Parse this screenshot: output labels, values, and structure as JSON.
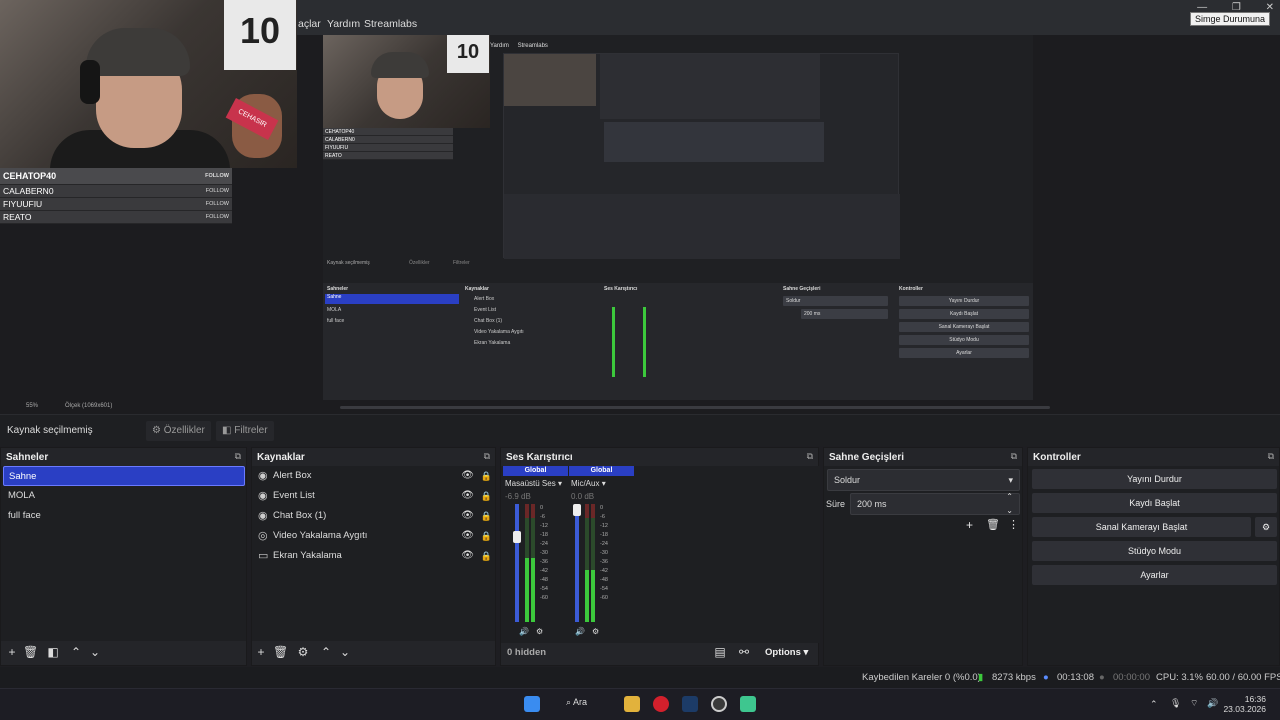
{
  "menubar": {
    "items": [
      "açlar",
      "Yardım",
      "Streamlabs"
    ],
    "tooltip": "Simge Durumuna",
    "window_controls": [
      "—",
      "❐",
      "✕"
    ]
  },
  "webcam": {
    "shirt_number": "10",
    "sign_text": "CEHASIR"
  },
  "chat": {
    "rows": [
      {
        "name": "CEHATOP40",
        "action": "FOLLOW"
      },
      {
        "name": "CALABERN0",
        "action": "FOLLOW"
      },
      {
        "name": "FIYUUFIU",
        "action": "FOLLOW"
      },
      {
        "name": "REATO",
        "action": "FOLLOW"
      }
    ]
  },
  "nested": {
    "menu": [
      "Yardım",
      "Streamlabs"
    ],
    "chat": [
      "CEHATOP40",
      "CALABERN0",
      "FIYUUFIU",
      "REATO"
    ],
    "source_label": "Kaynak seçilmemiş",
    "props_btn": "Özellikler",
    "filters_btn": "Filtreler",
    "panels": {
      "scenes_title": "Sahneler",
      "scenes": [
        "Sahne",
        "MOLA",
        "full face"
      ],
      "sources_title": "Kaynaklar",
      "sources": [
        "Alert Box",
        "Event List",
        "Chat Box (1)",
        "Video Yakalama Aygıtı",
        "Ekran Yakalama"
      ],
      "mixer_title": "Ses Karıştırıcı",
      "transitions_title": "Sahne Geçişleri",
      "transition": "Soldur",
      "duration": "200 ms",
      "controls_title": "Kontroller",
      "controls": [
        "Yayını Durdur",
        "Kaydı Başlat",
        "Sanal Kamerayı Başlat",
        "Stüdyo Modu",
        "Ayarlar"
      ]
    }
  },
  "zoom": {
    "percent": "55%",
    "scale_label": "Ölçek (1069x601)"
  },
  "source_bar": {
    "label": "Kaynak seçilmemiş",
    "properties": "Özellikler",
    "filters": "Filtreler"
  },
  "scenes": {
    "title": "Sahneler",
    "items": [
      "Sahne",
      "MOLA",
      "full face"
    ],
    "active_index": 0
  },
  "sources": {
    "title": "Kaynaklar",
    "items": [
      {
        "label": "Alert Box",
        "icon": "globe-icon"
      },
      {
        "label": "Event List",
        "icon": "globe-icon"
      },
      {
        "label": "Chat Box (1)",
        "icon": "globe-icon"
      },
      {
        "label": "Video Yakalama Aygıtı",
        "icon": "camera-icon"
      },
      {
        "label": "Ekran Yakalama",
        "icon": "monitor-icon"
      }
    ]
  },
  "mixer": {
    "title": "Ses Karıştırıcı",
    "channels": [
      {
        "header": "Global",
        "name": "Masaüstü Ses",
        "db": "-6.9 dB",
        "level": 0.62,
        "volume": 0.75
      },
      {
        "header": "Global",
        "name": "Mic/Aux",
        "db": "0.0 dB",
        "level": 0.5,
        "volume": 1.0
      }
    ],
    "scale": [
      "0",
      "-6",
      "-12",
      "-18",
      "-24",
      "-30",
      "-36",
      "-42",
      "-48",
      "-54",
      "-60"
    ],
    "hidden": "0 hidden",
    "options": "Options"
  },
  "transitions": {
    "title": "Sahne Geçişleri",
    "selected": "Soldur",
    "duration_label": "Süre",
    "duration_value": "200 ms"
  },
  "controls": {
    "title": "Kontroller",
    "buttons": [
      "Yayını Durdur",
      "Kaydı Başlat",
      "Sanal Kamerayı Başlat",
      "Stüdyo Modu",
      "Ayarlar"
    ]
  },
  "status": {
    "dropped": "Kaybedilen Kareler 0 (%0.0)",
    "bitrate": "8273 kbps",
    "stream_time": "00:13:08",
    "record_time": "00:00:00",
    "cpu": "CPU: 3.1%",
    "fps": "60.00 / 60.00 FPS"
  },
  "taskbar": {
    "search": "Ara",
    "time": "16:36",
    "date": "23.03.2026"
  },
  "colors": {
    "accent": "#2a3fc4",
    "meter_green": "#3cc93c",
    "bitrate_green": "#3cc93c"
  }
}
